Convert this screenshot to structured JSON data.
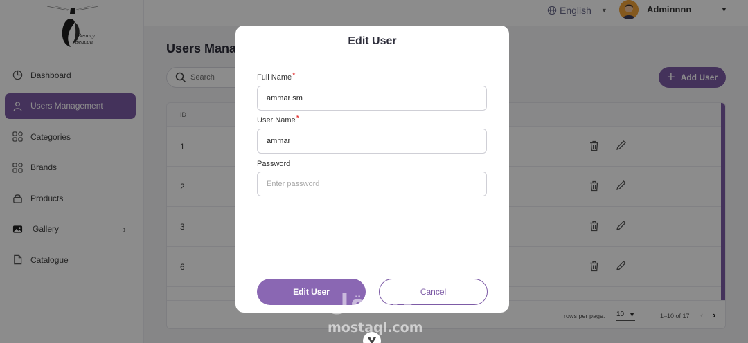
{
  "sidebar": {
    "logo_text": "Beauty Beacon",
    "items": [
      {
        "label": "Dashboard",
        "icon": "pie-chart-icon"
      },
      {
        "label": "Users Management",
        "icon": "user-icon",
        "active": true
      },
      {
        "label": "Categories",
        "icon": "grid-icon"
      },
      {
        "label": "Brands",
        "icon": "grid-icon"
      },
      {
        "label": "Products",
        "icon": "lock-icon"
      },
      {
        "label": "Gallery",
        "icon": "image-icon",
        "has_submenu": true
      },
      {
        "label": "Catalogue",
        "icon": "document-icon"
      }
    ]
  },
  "topbar": {
    "language": "English",
    "admin_name": "Adminnnn"
  },
  "page": {
    "title": "Users Management",
    "search_placeholder": "Search",
    "add_user_label": "Add User"
  },
  "table": {
    "headers": [
      "ID"
    ],
    "rows": [
      {
        "id": "1"
      },
      {
        "id": "2"
      },
      {
        "id": "3"
      },
      {
        "id": "6"
      }
    ],
    "footer": {
      "rows_per_page_label": "rows per page:",
      "rows_per_page": "10",
      "range": "1–10 of 17"
    }
  },
  "modal": {
    "title": "Edit User",
    "fields": {
      "full_name": {
        "label": "Full Name",
        "required_mark": "*",
        "value": "ammar sm"
      },
      "user_name": {
        "label": "User Name",
        "required_mark": "*",
        "value": "ammar"
      },
      "password": {
        "label": "Password",
        "placeholder": "Enter password",
        "value": ""
      }
    },
    "submit_label": "Edit User",
    "cancel_label": "Cancel"
  },
  "watermark": {
    "arabic": "مستقل",
    "latin": "mostaql.com"
  },
  "colors": {
    "accent": "#7d5ba6",
    "required": "#e02020"
  }
}
